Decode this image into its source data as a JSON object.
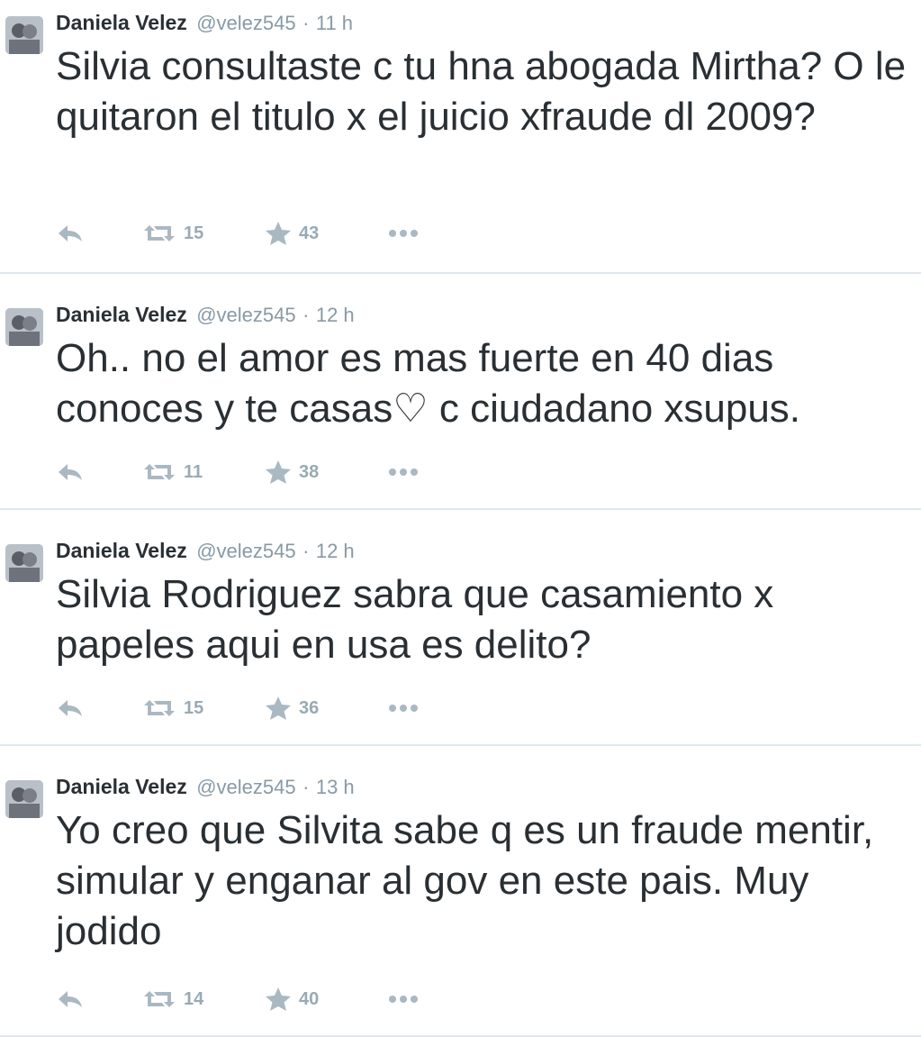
{
  "colors": {
    "text": "#292f33",
    "meta": "#8899a6",
    "icon": "#aab8c2",
    "divider": "#e1e8ed"
  },
  "tweets": [
    {
      "fullname": "Daniela Velez",
      "screenname": "@velez545",
      "separator": "·",
      "time": "11 h",
      "text": "Silvia consultaste c tu hna abogada Mirtha? O le quitaron el titulo x el juicio xfraude dl 2009?",
      "retweets": "15",
      "favorites": "43"
    },
    {
      "fullname": "Daniela Velez",
      "screenname": "@velez545",
      "separator": "·",
      "time": "12 h",
      "text": "Oh.. no el amor es mas fuerte en 40 dias conoces y te casas♡ c ciudadano xsupus.",
      "retweets": "11",
      "favorites": "38"
    },
    {
      "fullname": "Daniela Velez",
      "screenname": "@velez545",
      "separator": "·",
      "time": "12 h",
      "text": "Silvia Rodriguez sabra que casamiento x papeles aqui en usa es delito?",
      "retweets": "15",
      "favorites": "36"
    },
    {
      "fullname": "Daniela Velez",
      "screenname": "@velez545",
      "separator": "·",
      "time": "13 h",
      "text": "Yo creo que Silvita sabe q es un fraude mentir, simular y enganar al gov en este pais. Muy jodido",
      "retweets": "14",
      "favorites": "40"
    }
  ],
  "icons": {
    "avatar": "avatar-photo",
    "reply": "reply-icon",
    "retweet": "retweet-icon",
    "favorite": "star-icon",
    "more": "more-options-icon"
  }
}
